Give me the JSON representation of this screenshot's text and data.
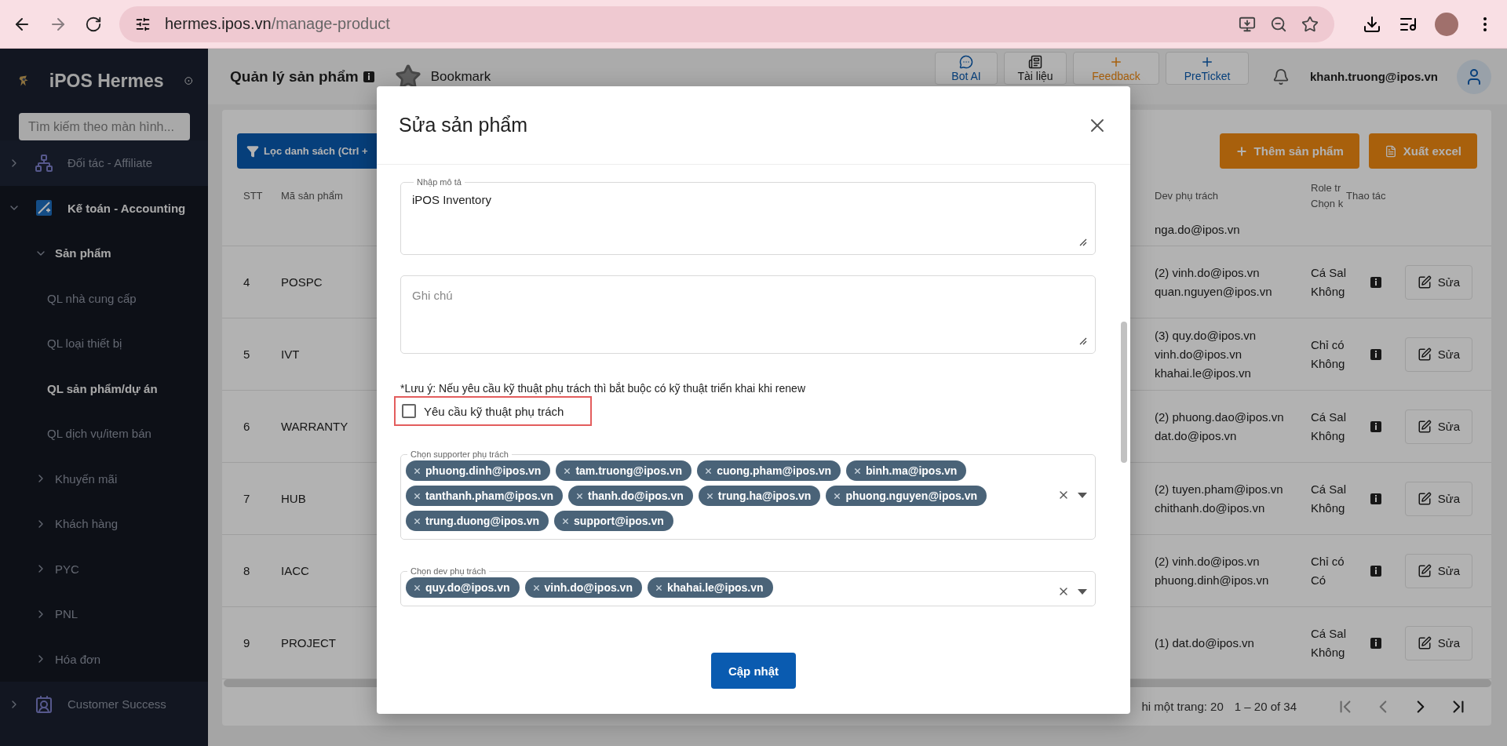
{
  "browser": {
    "host": "hermes.ipos.vn",
    "path": "/manage-product"
  },
  "sidebar": {
    "title": "iPOS Hermes",
    "search_placeholder": "Tìm kiếm theo màn hình...",
    "items": [
      {
        "label": "Đối tác - Affiliate",
        "expanded": false
      },
      {
        "label": "Kế toán - Accounting",
        "expanded": true,
        "children": [
          {
            "label": "Sản phẩm",
            "expanded": true,
            "children": [
              {
                "label": "QL nhà cung cấp",
                "selected": false
              },
              {
                "label": "QL loại thiết bị",
                "selected": false
              },
              {
                "label": "QL sản phẩm/dự án",
                "selected": true
              },
              {
                "label": "QL dịch vụ/item bán",
                "selected": false
              }
            ]
          },
          {
            "label": "Khuyến mãi",
            "expanded": false
          },
          {
            "label": "Khách hàng",
            "expanded": false
          },
          {
            "label": "PYC",
            "expanded": false
          },
          {
            "label": "PNL",
            "expanded": false
          },
          {
            "label": "Hóa đơn",
            "expanded": false
          }
        ]
      },
      {
        "label": "Customer Success",
        "expanded": false
      }
    ]
  },
  "header": {
    "title": "Quản lý sản phẩm",
    "bookmark": "Bookmark",
    "tools": [
      {
        "label": "Bot AI",
        "kind": "chat"
      },
      {
        "label": "Tài liệu",
        "kind": "docs"
      },
      {
        "label": "Feedback",
        "kind": "feedback"
      },
      {
        "label": "PreTicket",
        "kind": "ticket"
      }
    ],
    "user": "khanh.truong@ipos.vn"
  },
  "toolbar": {
    "filter_label": "Lọc danh sách (Ctrl +",
    "add_label": "Thêm sản phẩm",
    "export_label": "Xuất excel"
  },
  "table": {
    "columns": [
      [
        "STT"
      ],
      [
        "Mã sản phẩm"
      ],
      [
        "Dev phụ trách"
      ],
      [
        "Role tr",
        "Chọn k"
      ],
      [
        "Thao tác"
      ]
    ],
    "partial_row": {
      "dev": "nga.do@ipos.vn"
    },
    "rows": [
      {
        "stt": "4",
        "code": "POSPC",
        "dev": [
          "(2) vinh.do@ipos.vn",
          "quan.nguyen@ipos.vn"
        ],
        "role": [
          "Cá Sal",
          "Không"
        ],
        "action": "Sửa"
      },
      {
        "stt": "5",
        "code": "IVT",
        "dev": [
          "(3) quy.do@ipos.vn",
          "vinh.do@ipos.vn",
          "khahai.le@ipos.vn"
        ],
        "role": [
          "Chỉ có",
          "Không"
        ],
        "action": "Sửa"
      },
      {
        "stt": "6",
        "code": "WARRANTY",
        "dev": [
          "(2) phuong.dao@ipos.vn",
          "dat.do@ipos.vn"
        ],
        "role": [
          "Cá Sal",
          "Không"
        ],
        "action": "Sửa"
      },
      {
        "stt": "7",
        "code": "HUB",
        "dev": [
          "(2) tuyen.pham@ipos.vn",
          "chithanh.do@ipos.vn"
        ],
        "role": [
          "Cá Sal",
          "Không"
        ],
        "action": "Sửa"
      },
      {
        "stt": "8",
        "code": "IACC",
        "dev": [
          "(2) vinh.do@ipos.vn",
          "phuong.dinh@ipos.vn"
        ],
        "role": [
          "Chỉ có",
          "Có"
        ],
        "action": "Sửa"
      },
      {
        "stt": "9",
        "code": "PROJECT",
        "dev": [
          "(1) dat.do@ipos.vn"
        ],
        "role": [
          "Cá Sal",
          "Không"
        ],
        "action": "Sửa"
      }
    ]
  },
  "pagination": {
    "page_size": "hi một trang: 20",
    "range": "1 – 20 of 34"
  },
  "dialog": {
    "title": "Sửa sản phẩm",
    "description": {
      "label": "Nhập mô tả",
      "value": "iPOS Inventory"
    },
    "note": {
      "placeholder": "Ghi chú"
    },
    "notice": "*Lưu ý: Nếu yêu cầu kỹ thuật phụ trách thì bắt buộc có kỹ thuật triển khai khi renew",
    "require_tech": {
      "label": "Yêu cầu kỹ thuật phụ trách",
      "checked": false
    },
    "supporters": {
      "label": "Chọn supporter phụ trách",
      "chips": [
        "phuong.dinh@ipos.vn",
        "tam.truong@ipos.vn",
        "cuong.pham@ipos.vn",
        "binh.ma@ipos.vn",
        "tanthanh.pham@ipos.vn",
        "thanh.do@ipos.vn",
        "trung.ha@ipos.vn",
        "phuong.nguyen@ipos.vn",
        "trung.duong@ipos.vn",
        "support@ipos.vn"
      ]
    },
    "devs": {
      "label": "Chọn dev phụ trách",
      "chips": [
        "quy.do@ipos.vn",
        "vinh.do@ipos.vn",
        "khahai.le@ipos.vn"
      ]
    },
    "submit": "Cập nhật"
  }
}
